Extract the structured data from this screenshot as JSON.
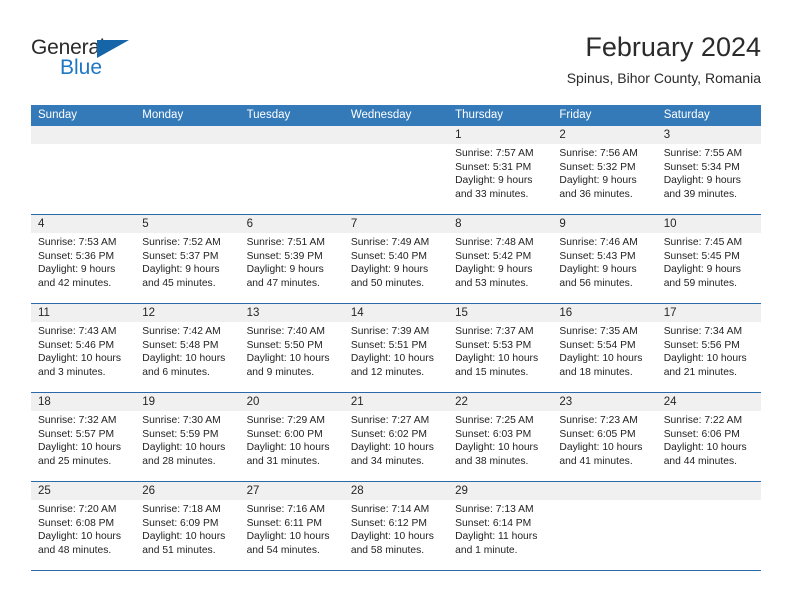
{
  "brand": {
    "name_top": "General",
    "name_bottom": "Blue",
    "accent_color": "#1f77c4",
    "triangle_color": "#1565a8"
  },
  "header": {
    "title": "February 2024",
    "subtitle": "Spinus, Bihor County, Romania"
  },
  "theme": {
    "header_blue": "#3479b8",
    "separator_blue": "#2a6aa8",
    "band_gray": "#f0f0f0"
  },
  "weekdays": [
    "Sunday",
    "Monday",
    "Tuesday",
    "Wednesday",
    "Thursday",
    "Friday",
    "Saturday"
  ],
  "weeks": [
    [
      {
        "day": "",
        "sunrise": "",
        "sunset": "",
        "daylight1": "",
        "daylight2": ""
      },
      {
        "day": "",
        "sunrise": "",
        "sunset": "",
        "daylight1": "",
        "daylight2": ""
      },
      {
        "day": "",
        "sunrise": "",
        "sunset": "",
        "daylight1": "",
        "daylight2": ""
      },
      {
        "day": "",
        "sunrise": "",
        "sunset": "",
        "daylight1": "",
        "daylight2": ""
      },
      {
        "day": "1",
        "sunrise": "Sunrise: 7:57 AM",
        "sunset": "Sunset: 5:31 PM",
        "daylight1": "Daylight: 9 hours",
        "daylight2": "and 33 minutes."
      },
      {
        "day": "2",
        "sunrise": "Sunrise: 7:56 AM",
        "sunset": "Sunset: 5:32 PM",
        "daylight1": "Daylight: 9 hours",
        "daylight2": "and 36 minutes."
      },
      {
        "day": "3",
        "sunrise": "Sunrise: 7:55 AM",
        "sunset": "Sunset: 5:34 PM",
        "daylight1": "Daylight: 9 hours",
        "daylight2": "and 39 minutes."
      }
    ],
    [
      {
        "day": "4",
        "sunrise": "Sunrise: 7:53 AM",
        "sunset": "Sunset: 5:36 PM",
        "daylight1": "Daylight: 9 hours",
        "daylight2": "and 42 minutes."
      },
      {
        "day": "5",
        "sunrise": "Sunrise: 7:52 AM",
        "sunset": "Sunset: 5:37 PM",
        "daylight1": "Daylight: 9 hours",
        "daylight2": "and 45 minutes."
      },
      {
        "day": "6",
        "sunrise": "Sunrise: 7:51 AM",
        "sunset": "Sunset: 5:39 PM",
        "daylight1": "Daylight: 9 hours",
        "daylight2": "and 47 minutes."
      },
      {
        "day": "7",
        "sunrise": "Sunrise: 7:49 AM",
        "sunset": "Sunset: 5:40 PM",
        "daylight1": "Daylight: 9 hours",
        "daylight2": "and 50 minutes."
      },
      {
        "day": "8",
        "sunrise": "Sunrise: 7:48 AM",
        "sunset": "Sunset: 5:42 PM",
        "daylight1": "Daylight: 9 hours",
        "daylight2": "and 53 minutes."
      },
      {
        "day": "9",
        "sunrise": "Sunrise: 7:46 AM",
        "sunset": "Sunset: 5:43 PM",
        "daylight1": "Daylight: 9 hours",
        "daylight2": "and 56 minutes."
      },
      {
        "day": "10",
        "sunrise": "Sunrise: 7:45 AM",
        "sunset": "Sunset: 5:45 PM",
        "daylight1": "Daylight: 9 hours",
        "daylight2": "and 59 minutes."
      }
    ],
    [
      {
        "day": "11",
        "sunrise": "Sunrise: 7:43 AM",
        "sunset": "Sunset: 5:46 PM",
        "daylight1": "Daylight: 10 hours",
        "daylight2": "and 3 minutes."
      },
      {
        "day": "12",
        "sunrise": "Sunrise: 7:42 AM",
        "sunset": "Sunset: 5:48 PM",
        "daylight1": "Daylight: 10 hours",
        "daylight2": "and 6 minutes."
      },
      {
        "day": "13",
        "sunrise": "Sunrise: 7:40 AM",
        "sunset": "Sunset: 5:50 PM",
        "daylight1": "Daylight: 10 hours",
        "daylight2": "and 9 minutes."
      },
      {
        "day": "14",
        "sunrise": "Sunrise: 7:39 AM",
        "sunset": "Sunset: 5:51 PM",
        "daylight1": "Daylight: 10 hours",
        "daylight2": "and 12 minutes."
      },
      {
        "day": "15",
        "sunrise": "Sunrise: 7:37 AM",
        "sunset": "Sunset: 5:53 PM",
        "daylight1": "Daylight: 10 hours",
        "daylight2": "and 15 minutes."
      },
      {
        "day": "16",
        "sunrise": "Sunrise: 7:35 AM",
        "sunset": "Sunset: 5:54 PM",
        "daylight1": "Daylight: 10 hours",
        "daylight2": "and 18 minutes."
      },
      {
        "day": "17",
        "sunrise": "Sunrise: 7:34 AM",
        "sunset": "Sunset: 5:56 PM",
        "daylight1": "Daylight: 10 hours",
        "daylight2": "and 21 minutes."
      }
    ],
    [
      {
        "day": "18",
        "sunrise": "Sunrise: 7:32 AM",
        "sunset": "Sunset: 5:57 PM",
        "daylight1": "Daylight: 10 hours",
        "daylight2": "and 25 minutes."
      },
      {
        "day": "19",
        "sunrise": "Sunrise: 7:30 AM",
        "sunset": "Sunset: 5:59 PM",
        "daylight1": "Daylight: 10 hours",
        "daylight2": "and 28 minutes."
      },
      {
        "day": "20",
        "sunrise": "Sunrise: 7:29 AM",
        "sunset": "Sunset: 6:00 PM",
        "daylight1": "Daylight: 10 hours",
        "daylight2": "and 31 minutes."
      },
      {
        "day": "21",
        "sunrise": "Sunrise: 7:27 AM",
        "sunset": "Sunset: 6:02 PM",
        "daylight1": "Daylight: 10 hours",
        "daylight2": "and 34 minutes."
      },
      {
        "day": "22",
        "sunrise": "Sunrise: 7:25 AM",
        "sunset": "Sunset: 6:03 PM",
        "daylight1": "Daylight: 10 hours",
        "daylight2": "and 38 minutes."
      },
      {
        "day": "23",
        "sunrise": "Sunrise: 7:23 AM",
        "sunset": "Sunset: 6:05 PM",
        "daylight1": "Daylight: 10 hours",
        "daylight2": "and 41 minutes."
      },
      {
        "day": "24",
        "sunrise": "Sunrise: 7:22 AM",
        "sunset": "Sunset: 6:06 PM",
        "daylight1": "Daylight: 10 hours",
        "daylight2": "and 44 minutes."
      }
    ],
    [
      {
        "day": "25",
        "sunrise": "Sunrise: 7:20 AM",
        "sunset": "Sunset: 6:08 PM",
        "daylight1": "Daylight: 10 hours",
        "daylight2": "and 48 minutes."
      },
      {
        "day": "26",
        "sunrise": "Sunrise: 7:18 AM",
        "sunset": "Sunset: 6:09 PM",
        "daylight1": "Daylight: 10 hours",
        "daylight2": "and 51 minutes."
      },
      {
        "day": "27",
        "sunrise": "Sunrise: 7:16 AM",
        "sunset": "Sunset: 6:11 PM",
        "daylight1": "Daylight: 10 hours",
        "daylight2": "and 54 minutes."
      },
      {
        "day": "28",
        "sunrise": "Sunrise: 7:14 AM",
        "sunset": "Sunset: 6:12 PM",
        "daylight1": "Daylight: 10 hours",
        "daylight2": "and 58 minutes."
      },
      {
        "day": "29",
        "sunrise": "Sunrise: 7:13 AM",
        "sunset": "Sunset: 6:14 PM",
        "daylight1": "Daylight: 11 hours",
        "daylight2": "and 1 minute."
      },
      {
        "day": "",
        "sunrise": "",
        "sunset": "",
        "daylight1": "",
        "daylight2": ""
      },
      {
        "day": "",
        "sunrise": "",
        "sunset": "",
        "daylight1": "",
        "daylight2": ""
      }
    ]
  ]
}
